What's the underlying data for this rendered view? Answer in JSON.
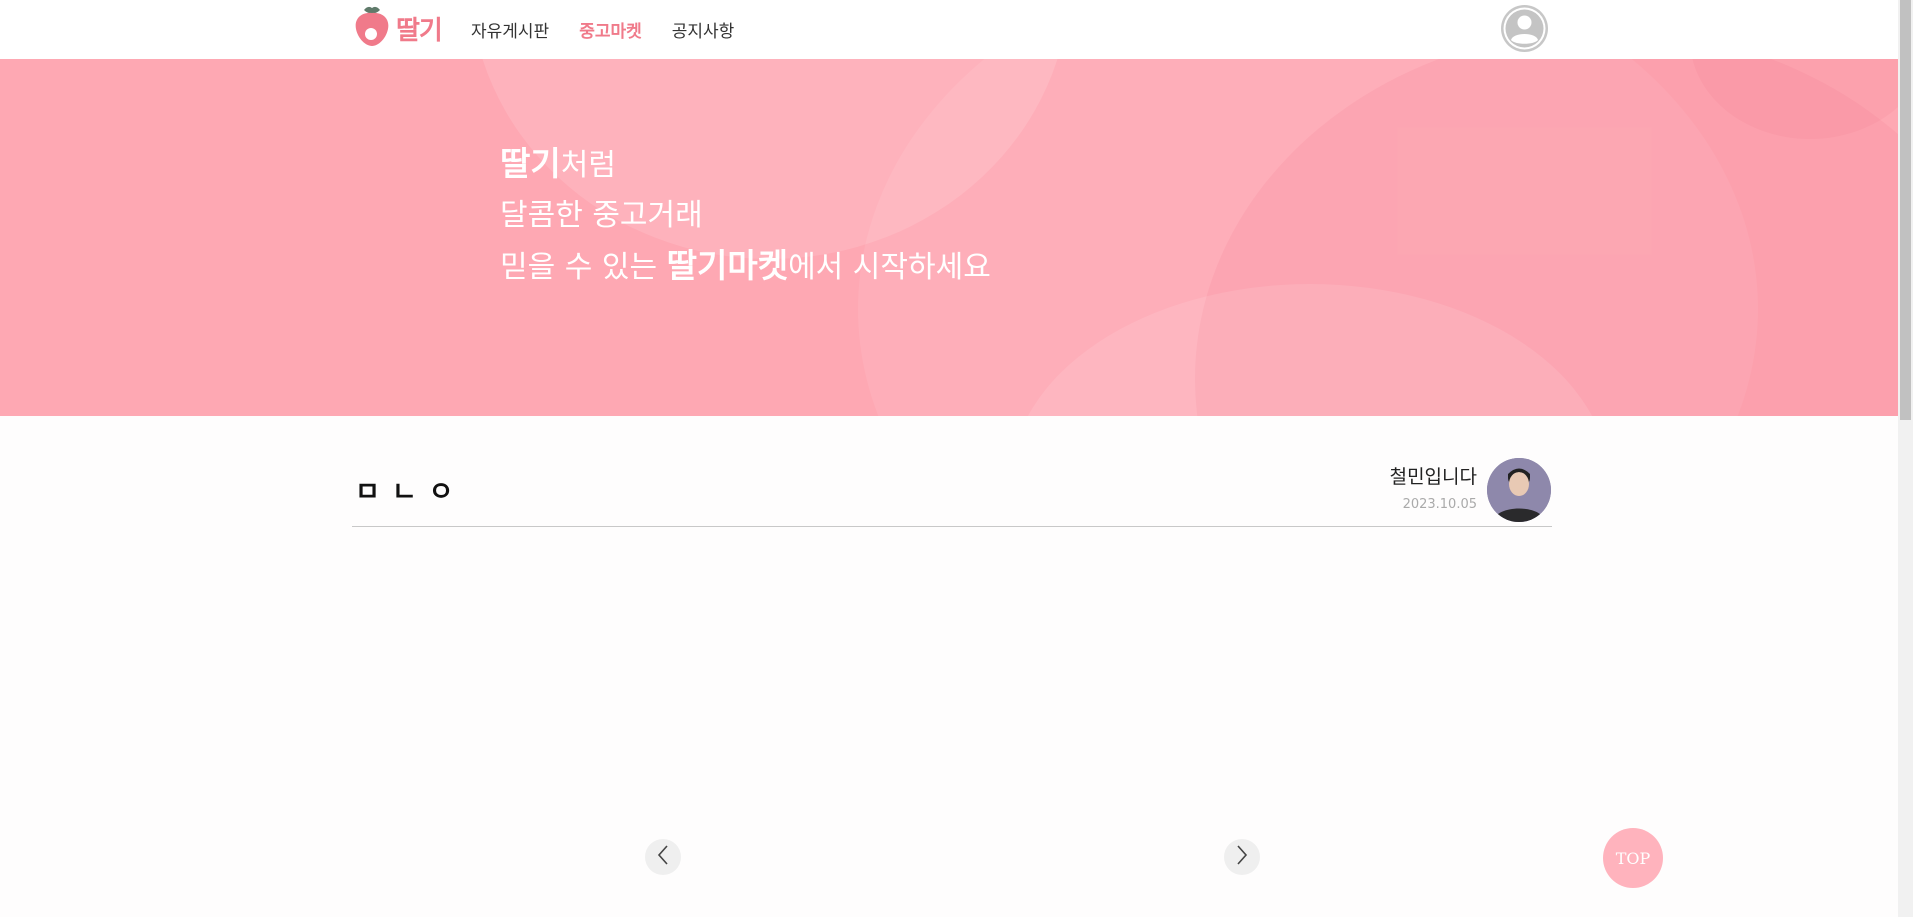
{
  "header": {
    "logo_text": "딸기",
    "nav": [
      {
        "label": "자유게시판",
        "active": false
      },
      {
        "label": "중고마켓",
        "active": true
      },
      {
        "label": "공지사항",
        "active": false
      }
    ],
    "accent_color": "#f07a8a"
  },
  "banner": {
    "line1_bold": "딸기",
    "line1_rest": "처럼",
    "line2": "달콤한 중고거래",
    "line3_start": "믿을 수 있는 ",
    "line3_bold": "딸기마켓",
    "line3_end": "에서 시작하세요",
    "background_color": "#fea8b3"
  },
  "post": {
    "title": "ㅁㄴㅇ",
    "author": "철민입니다",
    "date": "2023.10.05"
  },
  "carousel": {
    "prev_icon": "chevron-left-icon",
    "next_icon": "chevron-right-icon"
  },
  "top_button": {
    "label": "TOP"
  }
}
